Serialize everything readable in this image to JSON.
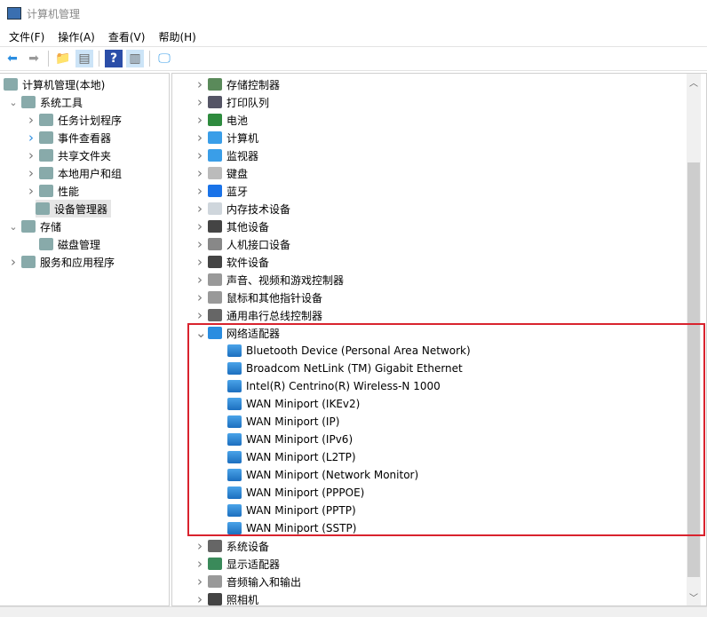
{
  "window": {
    "title": "计算机管理"
  },
  "menu": [
    "文件(F)",
    "操作(A)",
    "查看(V)",
    "帮助(H)"
  ],
  "toolbar": [
    "back-icon",
    "forward-icon",
    "up-folder-icon",
    "show-hide-tree-icon",
    "help-icon",
    "show-action-pane-icon",
    "monitor-icon"
  ],
  "tree": [
    {
      "label": "计算机管理(本地)",
      "level": 0,
      "chevron": "",
      "icon": "computer-management-icon"
    },
    {
      "label": "系统工具",
      "level": 1,
      "chevron": "down",
      "icon": "tools-icon"
    },
    {
      "label": "任务计划程序",
      "level": 2,
      "chevron": "right",
      "icon": "clock-icon"
    },
    {
      "label": "事件查看器",
      "level": 2,
      "chevron": "right-blue",
      "icon": "event-viewer-icon"
    },
    {
      "label": "共享文件夹",
      "level": 2,
      "chevron": "right",
      "icon": "shared-folder-icon"
    },
    {
      "label": "本地用户和组",
      "level": 2,
      "chevron": "right",
      "icon": "users-icon"
    },
    {
      "label": "性能",
      "level": 2,
      "chevron": "right",
      "icon": "performance-icon"
    },
    {
      "label": "设备管理器",
      "level": 2,
      "chevron": "",
      "icon": "device-manager-icon",
      "selected": true
    },
    {
      "label": "存储",
      "level": 1,
      "chevron": "down",
      "icon": "storage-icon"
    },
    {
      "label": "磁盘管理",
      "level": 2,
      "chevron": "",
      "icon": "disk-icon"
    },
    {
      "label": "服务和应用程序",
      "level": 1,
      "chevron": "right",
      "icon": "services-icon"
    }
  ],
  "devices": [
    {
      "label": "存储控制器",
      "icon": "storage-controller-icon",
      "color": "#5a8a5a"
    },
    {
      "label": "打印队列",
      "icon": "printer-icon",
      "color": "#556"
    },
    {
      "label": "电池",
      "icon": "battery-icon",
      "color": "#2e8b3e"
    },
    {
      "label": "计算机",
      "icon": "computer-icon",
      "color": "#3a9ee8"
    },
    {
      "label": "监视器",
      "icon": "monitor-icon",
      "color": "#3a9ee8"
    },
    {
      "label": "键盘",
      "icon": "keyboard-icon",
      "color": "#bbb"
    },
    {
      "label": "蓝牙",
      "icon": "bluetooth-icon",
      "color": "#1a73e8"
    },
    {
      "label": "内存技术设备",
      "icon": "memory-device-icon",
      "color": "#cfd6dc"
    },
    {
      "label": "其他设备",
      "icon": "unknown-device-icon",
      "color": "#444"
    },
    {
      "label": "人机接口设备",
      "icon": "hid-icon",
      "color": "#888"
    },
    {
      "label": "软件设备",
      "icon": "software-device-icon",
      "color": "#444"
    },
    {
      "label": "声音、视频和游戏控制器",
      "icon": "speaker-icon",
      "color": "#999"
    },
    {
      "label": "鼠标和其他指针设备",
      "icon": "mouse-icon",
      "color": "#999"
    },
    {
      "label": "通用串行总线控制器",
      "icon": "usb-icon",
      "color": "#666"
    },
    {
      "label": "网络适配器",
      "icon": "network-adapter-icon",
      "color": "#2a8de0",
      "expanded": true,
      "children": [
        "Bluetooth Device (Personal Area Network)",
        "Broadcom NetLink (TM) Gigabit Ethernet",
        "Intel(R) Centrino(R) Wireless-N 1000",
        "WAN Miniport (IKEv2)",
        "WAN Miniport (IP)",
        "WAN Miniport (IPv6)",
        "WAN Miniport (L2TP)",
        "WAN Miniport (Network Monitor)",
        "WAN Miniport (PPPOE)",
        "WAN Miniport (PPTP)",
        "WAN Miniport (SSTP)"
      ]
    },
    {
      "label": "系统设备",
      "icon": "system-device-icon",
      "color": "#666"
    },
    {
      "label": "显示适配器",
      "icon": "display-adapter-icon",
      "color": "#3a8a5a"
    },
    {
      "label": "音频输入和输出",
      "icon": "audio-icon",
      "color": "#999"
    },
    {
      "label": "照相机",
      "icon": "camera-icon",
      "color": "#444"
    }
  ],
  "colors": {
    "highlight": "#d9232e",
    "selection": "#e5e5e5"
  }
}
